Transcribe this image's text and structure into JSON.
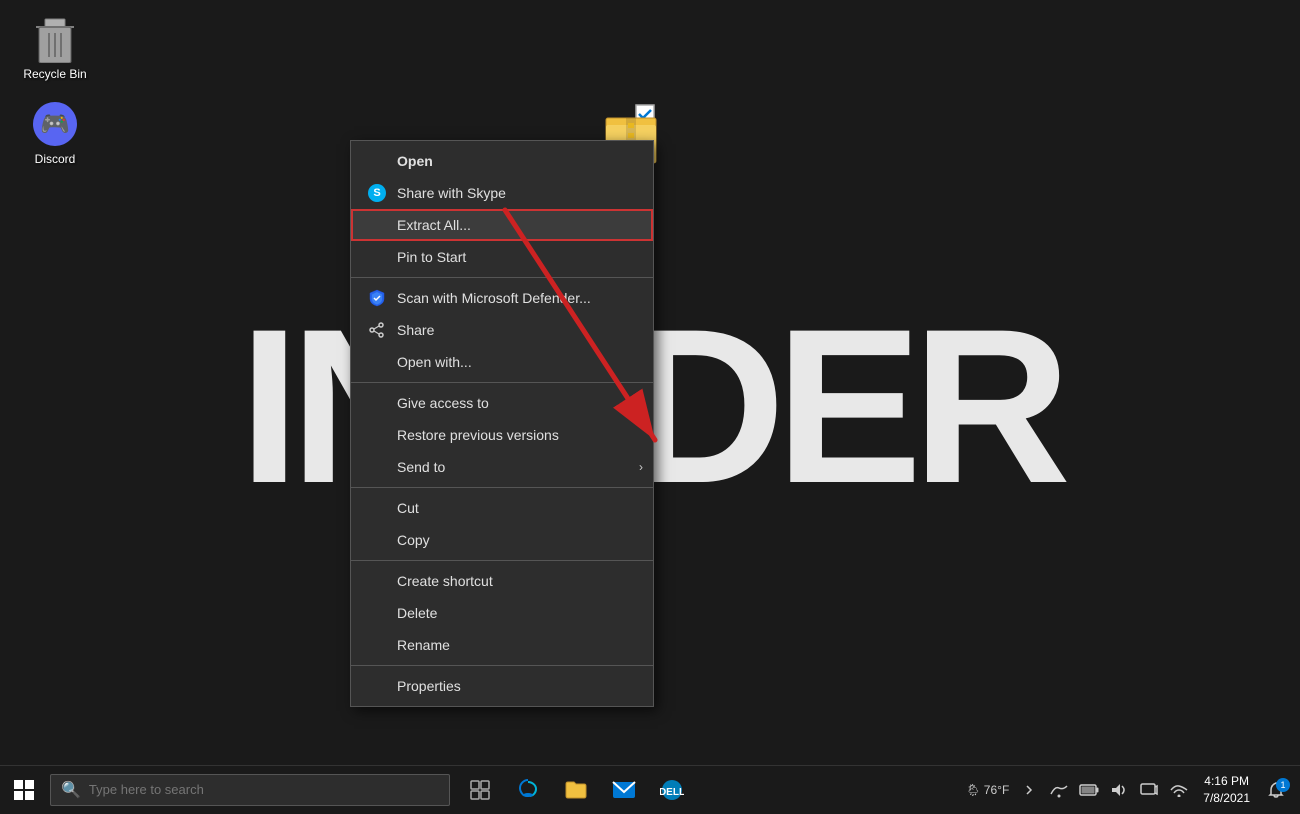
{
  "desktop": {
    "background_text": "INSIDER",
    "icons": [
      {
        "id": "recycle-bin",
        "label": "Recycle Bin"
      },
      {
        "id": "discord",
        "label": "Discord"
      }
    ]
  },
  "context_menu": {
    "items": [
      {
        "id": "open",
        "label": "Open",
        "icon": "",
        "has_submenu": false,
        "bold": true
      },
      {
        "id": "share-with-skype",
        "label": "Share with Skype",
        "icon": "skype",
        "has_submenu": false
      },
      {
        "id": "extract-all",
        "label": "Extract All...",
        "icon": "",
        "has_submenu": false,
        "highlighted": true
      },
      {
        "id": "pin-to-start",
        "label": "Pin to Start",
        "icon": "",
        "has_submenu": false
      },
      {
        "id": "scan-defender",
        "label": "Scan with Microsoft Defender...",
        "icon": "defender",
        "has_submenu": false
      },
      {
        "id": "share",
        "label": "Share",
        "icon": "share",
        "has_submenu": false
      },
      {
        "id": "open-with",
        "label": "Open with...",
        "icon": "",
        "has_submenu": false
      },
      {
        "id": "give-access",
        "label": "Give access to",
        "icon": "",
        "has_submenu": true
      },
      {
        "id": "restore-versions",
        "label": "Restore previous versions",
        "icon": "",
        "has_submenu": false
      },
      {
        "id": "send-to",
        "label": "Send to",
        "icon": "",
        "has_submenu": true
      },
      {
        "id": "cut",
        "label": "Cut",
        "icon": "",
        "has_submenu": false
      },
      {
        "id": "copy",
        "label": "Copy",
        "icon": "",
        "has_submenu": false
      },
      {
        "id": "create-shortcut",
        "label": "Create shortcut",
        "icon": "",
        "has_submenu": false
      },
      {
        "id": "delete",
        "label": "Delete",
        "icon": "",
        "has_submenu": false
      },
      {
        "id": "rename",
        "label": "Rename",
        "icon": "",
        "has_submenu": false
      },
      {
        "id": "properties",
        "label": "Properties",
        "icon": "",
        "has_submenu": false
      }
    ]
  },
  "taskbar": {
    "search_placeholder": "Type here to search",
    "clock": {
      "time": "4:16 PM",
      "date": "7/8/2021"
    },
    "weather": {
      "icon": "🌦",
      "temp": "76°F"
    },
    "notification_count": "1"
  }
}
